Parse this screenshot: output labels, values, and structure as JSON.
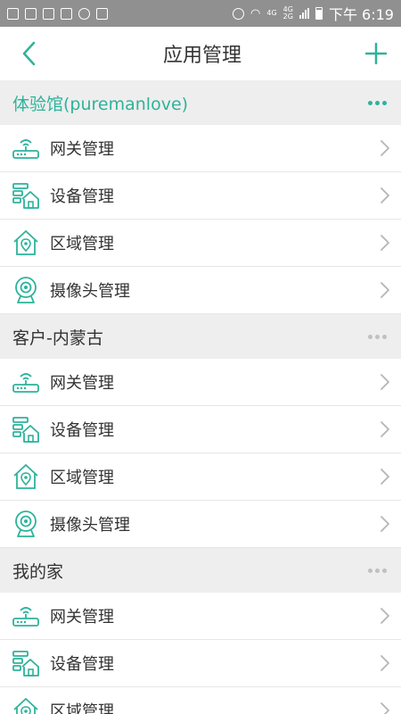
{
  "status_bar": {
    "network": "4G",
    "network2": "4G",
    "network3": "2G",
    "time": "下午 6:19"
  },
  "header": {
    "title": "应用管理"
  },
  "icons": {
    "back": "chevron-left-icon",
    "add": "plus-icon",
    "more": "more-dots-icon"
  },
  "colors": {
    "accent": "#2db39b",
    "section_bg": "#eeeeee",
    "status_bg": "#909090"
  },
  "sections": [
    {
      "title": "体验馆(puremanlove)",
      "active": true,
      "items": [
        {
          "label": "网关管理",
          "icon": "gateway-router-icon"
        },
        {
          "label": "设备管理",
          "icon": "device-house-icon"
        },
        {
          "label": "区域管理",
          "icon": "area-house-icon"
        },
        {
          "label": "摄像头管理",
          "icon": "camera-icon"
        }
      ]
    },
    {
      "title": "客户-内蒙古",
      "active": false,
      "items": [
        {
          "label": "网关管理",
          "icon": "gateway-router-icon"
        },
        {
          "label": "设备管理",
          "icon": "device-house-icon"
        },
        {
          "label": "区域管理",
          "icon": "area-house-icon"
        },
        {
          "label": "摄像头管理",
          "icon": "camera-icon"
        }
      ]
    },
    {
      "title": "我的家",
      "active": false,
      "items": [
        {
          "label": "网关管理",
          "icon": "gateway-router-icon"
        },
        {
          "label": "设备管理",
          "icon": "device-house-icon"
        },
        {
          "label": "区域管理",
          "icon": "area-house-icon"
        }
      ]
    }
  ]
}
